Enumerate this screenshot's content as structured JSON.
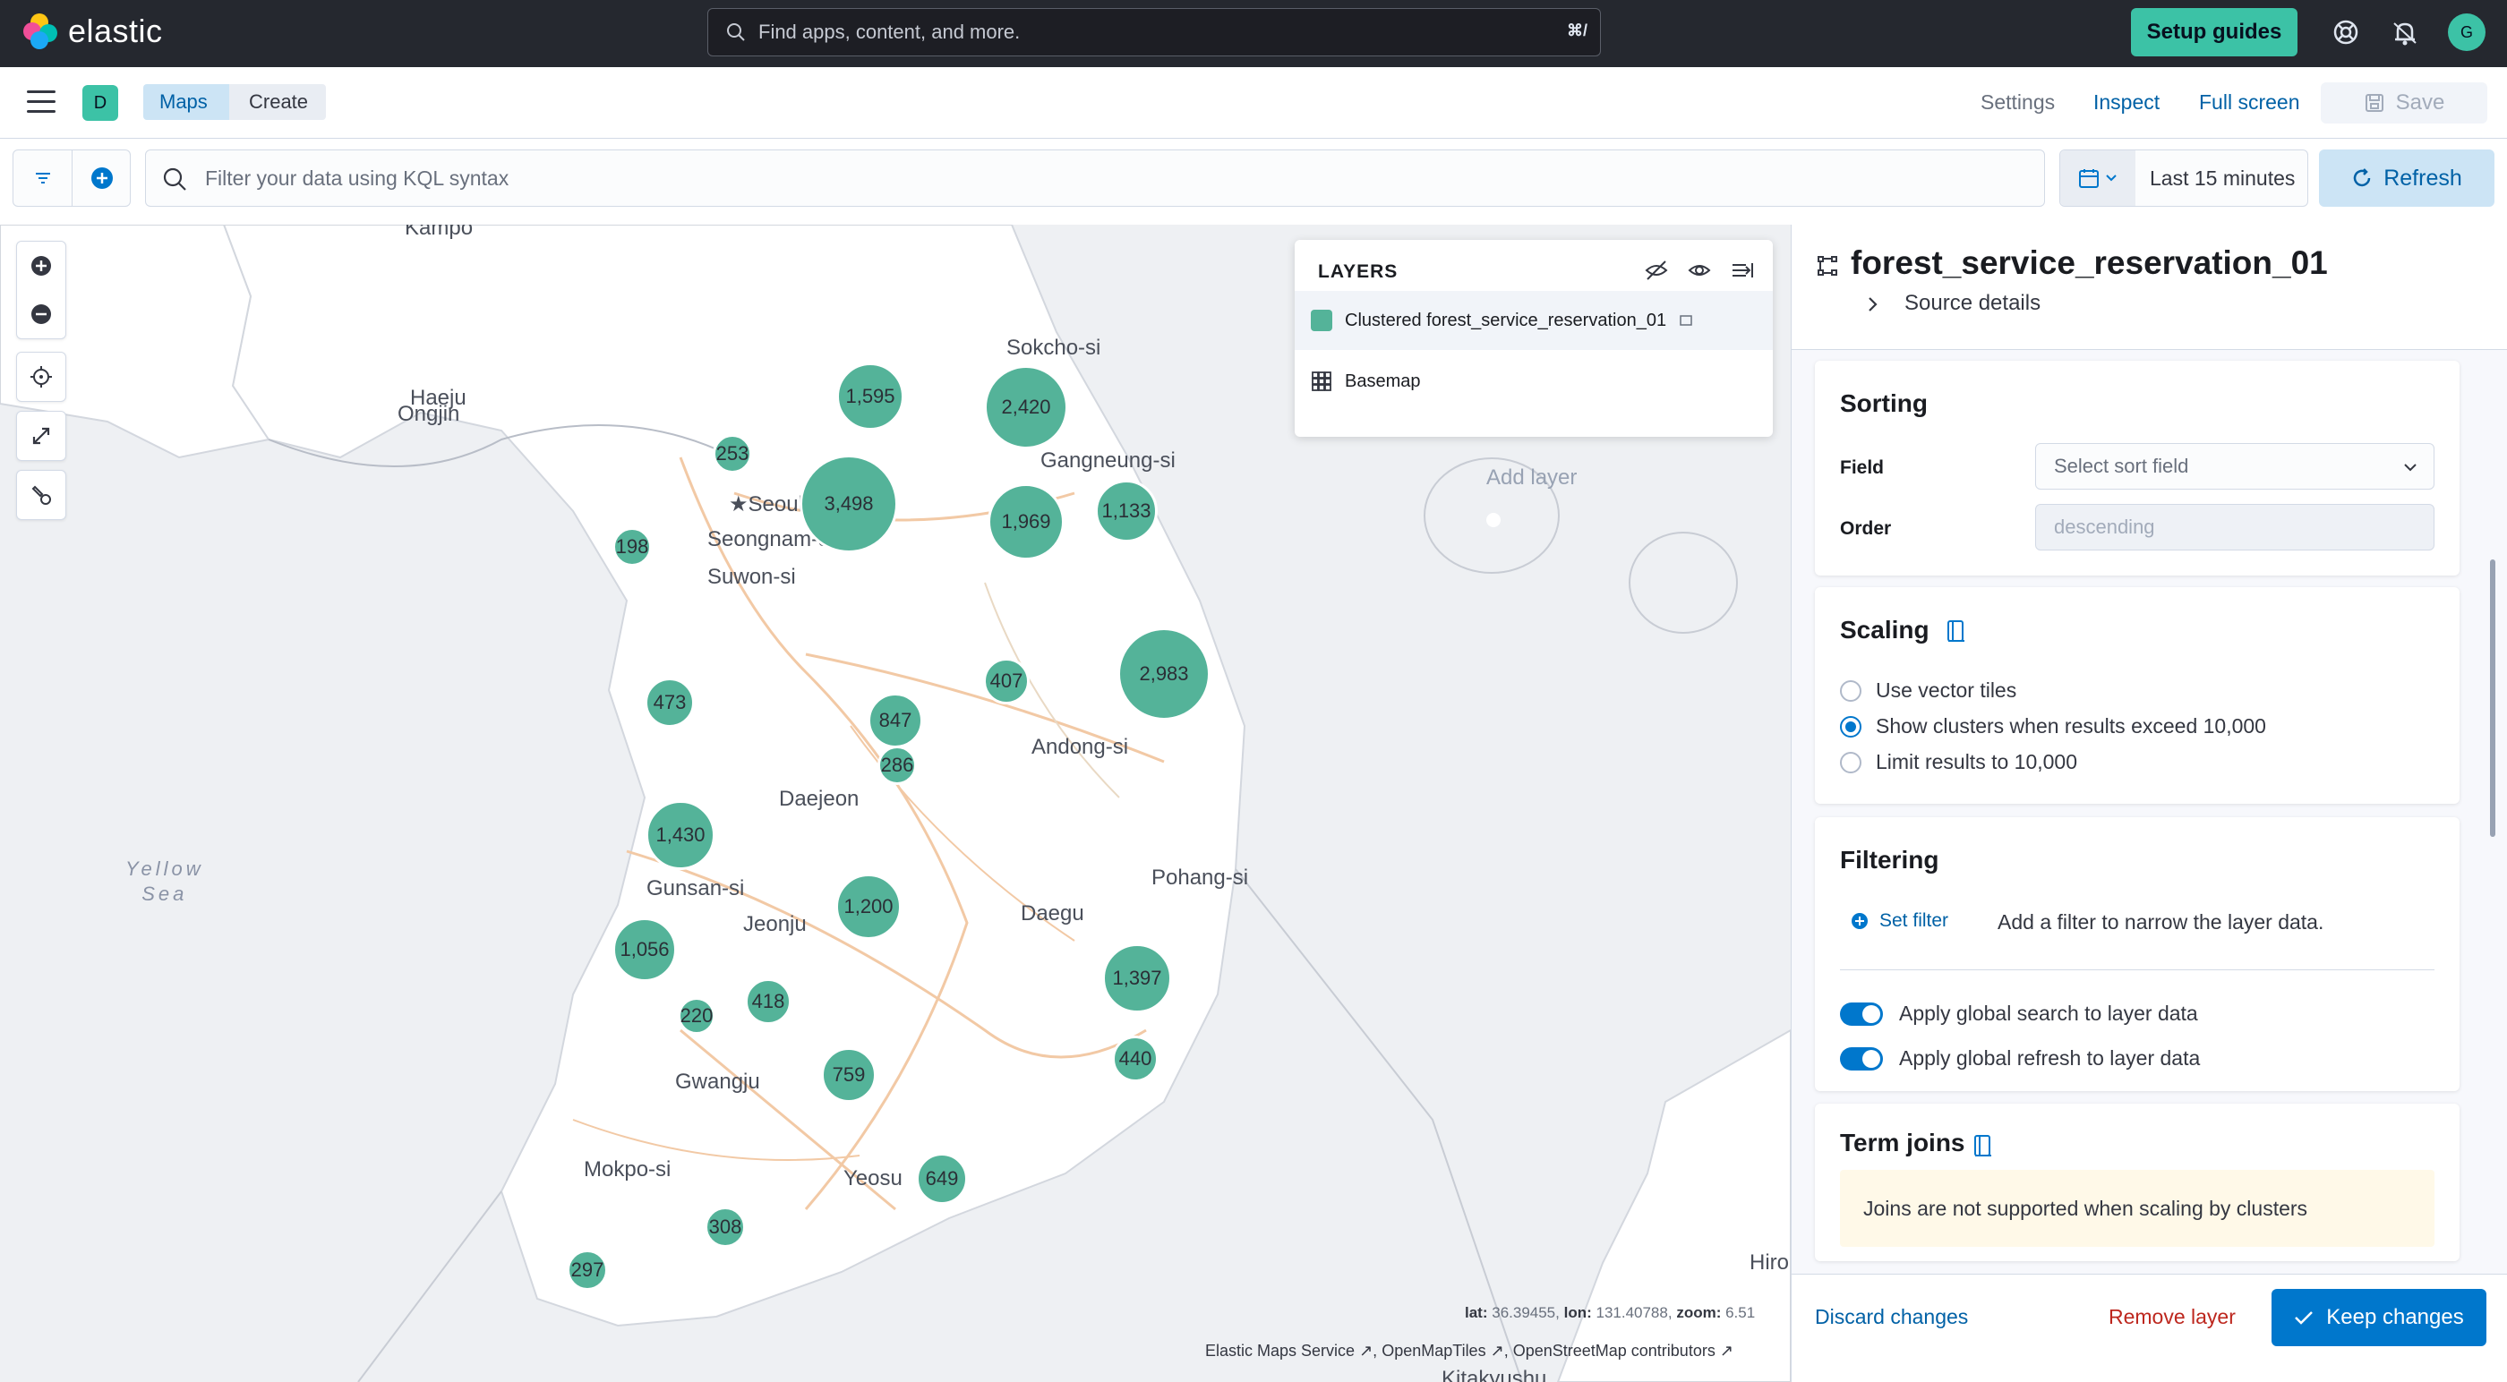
{
  "header": {
    "brand": "elastic",
    "search_placeholder": "Find apps, content, and more.",
    "search_shortcut": "⌘/",
    "setup_guides": "Setup guides",
    "avatar": "G"
  },
  "appbar": {
    "space": "D",
    "breadcrumbs": [
      "Maps",
      "Create"
    ],
    "settings": "Settings",
    "inspect": "Inspect",
    "full_screen": "Full screen",
    "save": "Save"
  },
  "querybar": {
    "kql_placeholder": "Filter your data using KQL syntax",
    "time_range": "Last 15 minutes",
    "refresh": "Refresh"
  },
  "map": {
    "labels": {
      "haeju": "Haeju",
      "ongjin": "Ongjin",
      "seoul": "★Seoul",
      "seongnam": "Seongnam-si",
      "suwon": "Suwon-si",
      "sokcho": "Sokcho-si",
      "gangneung": "Gangneung-si",
      "andong": "Andong-si",
      "daejeon": "Daejeon",
      "gunsan": "Gunsan-si",
      "jeonju": "Jeonju",
      "daegu": "Daegu",
      "pohang": "Pohang-si",
      "gwangju": "Gwangju",
      "mokpo": "Mokpo-si",
      "yeosu": "Yeosu",
      "hiro": "Hiro",
      "yellow_sea": "Yellow\nSea",
      "kampo": "Kampo",
      "kitakyushu": "Kitakyushu"
    },
    "clusters": {
      "c1595": "1,595",
      "c2420": "2,420",
      "c253": "253",
      "c3498": "3,498",
      "c1969": "1,969",
      "c1133": "1,133",
      "c198": "198",
      "c407": "407",
      "c2983": "2,983",
      "c473": "473",
      "c847": "847",
      "c286": "286",
      "c1430": "1,430",
      "c1200": "1,200",
      "c1056": "1,056",
      "c1397": "1,397",
      "c418": "418",
      "c220": "220",
      "c440": "440",
      "c759": "759",
      "c649": "649",
      "c308": "308",
      "c297": "297"
    },
    "coords": {
      "lat_label": "lat:",
      "lat": "36.39455",
      "lon_label": "lon:",
      "lon": "131.40788",
      "zoom_label": "zoom:",
      "zoom": "6.51"
    },
    "attribution": {
      "ems": "Elastic Maps Service",
      "omt": "OpenMapTiles",
      "osm": "OpenStreetMap contributors"
    }
  },
  "layers": {
    "title": "LAYERS",
    "items": [
      "Clustered forest_service_reservation_01",
      "Basemap"
    ],
    "add_layer": "Add layer"
  },
  "panel": {
    "title": "forest_service_reservation_01",
    "source_details": "Source details",
    "sorting": {
      "title": "Sorting",
      "field_label": "Field",
      "field_placeholder": "Select sort field",
      "order_label": "Order",
      "order_value": "descending"
    },
    "scaling": {
      "title": "Scaling",
      "options": [
        "Use vector tiles",
        "Show clusters when results exceed 10,000",
        "Limit results to 10,000"
      ],
      "selected": 1
    },
    "filtering": {
      "title": "Filtering",
      "set_filter": "Set filter",
      "hint": "Add a filter to narrow the layer data.",
      "global_search": "Apply global search to layer data",
      "global_refresh": "Apply global refresh to layer data"
    },
    "term_joins": {
      "title": "Term joins",
      "callout": "Joins are not supported when scaling by clusters"
    },
    "footer": {
      "discard": "Discard changes",
      "remove": "Remove layer",
      "keep": "Keep changes"
    }
  },
  "colors": {
    "accent": "#0077cc",
    "cluster": "#54b399",
    "header_bg": "#25282f",
    "setup": "#3cc2a6",
    "danger": "#bd271e"
  }
}
